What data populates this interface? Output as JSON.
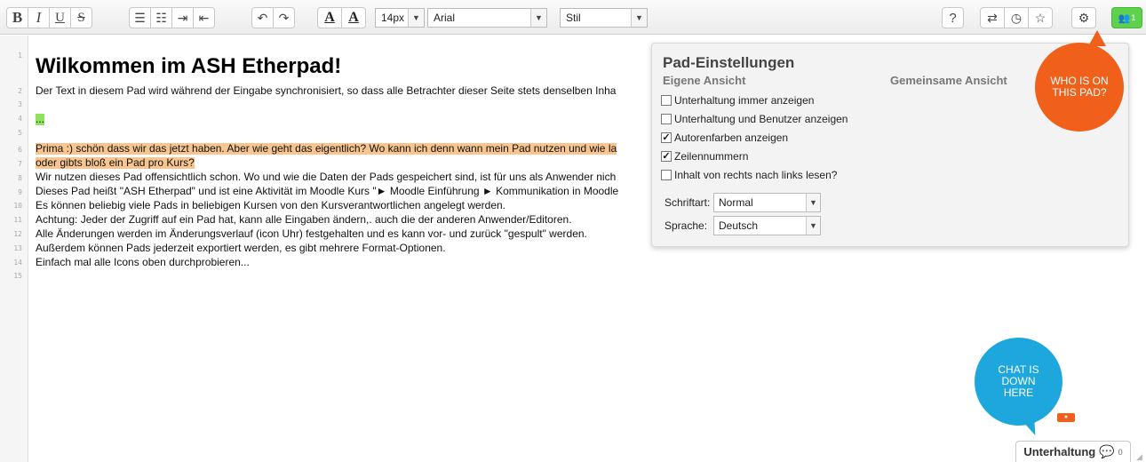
{
  "toolbar": {
    "bold_label": "B",
    "italic_label": "I",
    "underline_label": "U",
    "strike_label": "S",
    "font_color_label": "A",
    "bg_color_label": "A",
    "font_size": "14px",
    "font_family": "Arial",
    "style_select": "Stil",
    "help_label": "?",
    "user_count": "1"
  },
  "editor": {
    "line_numbers": [
      "1",
      "2",
      "3",
      "4",
      "5",
      "6",
      "7",
      "8",
      "9",
      "10",
      "11",
      "12",
      "13",
      "14",
      "15"
    ],
    "title": "Wilkommen im ASH Etherpad!",
    "line2": "Der Text in diesem Pad wird während der Eingabe synchronisiert, so dass alle Betrachter dieser Seite stets denselben Inha",
    "line4": "...",
    "line6": "Prima :) schön dass wir das jetzt haben. Aber wie geht das eigentlich? Wo kann ich denn wann mein Pad nutzen und wie la",
    "line7": "oder gibts bloß ein Pad pro Kurs?",
    "line8": "Wir nutzen dieses Pad offensichtlich schon.  Wo und wie die Daten der Pads gespeichert sind, ist für uns als Anwender nich",
    "line9": "Dieses Pad heißt \"ASH Etherpad\" und ist eine Aktivität im Moodle Kurs \"► Moodle Einführung  ► Kommunikation in Moodle",
    "line10": "Es können beliebig viele Pads in beliebigen Kursen von den Kursverantwortlichen angelegt werden.",
    "line11": "Achtung: Jeder der Zugriff auf ein Pad hat, kann alle Eingaben ändern,. auch die der anderen Anwender/Editoren.",
    "line12": "Alle Änderungen werden im Änderungsverlauf (icon Uhr)  festgehalten und es kann vor- und zurück \"gespult\" werden.",
    "line13": "Außerdem können Pads jederzeit  exportiert werden, es gibt mehrere Format-Optionen.",
    "line14": "Einfach mal alle Icons oben durchprobieren..."
  },
  "settings": {
    "title": "Pad-Einstellungen",
    "own_view": "Eigene Ansicht",
    "shared_view": "Gemeinsame Ansicht",
    "options": [
      {
        "label": "Unterhaltung immer anzeigen",
        "checked": "false"
      },
      {
        "label": "Unterhaltung und Benutzer anzeigen",
        "checked": "false"
      },
      {
        "label": "Autorenfarben anzeigen",
        "checked": "true"
      },
      {
        "label": "Zeilennummern",
        "checked": "true"
      },
      {
        "label": "Inhalt von rechts nach links lesen?",
        "checked": "false"
      }
    ],
    "font_label": "Schriftart:",
    "font_value": "Normal",
    "lang_label": "Sprache:",
    "lang_value": "Deutsch"
  },
  "bubbles": {
    "who": "WHO IS ON THIS PAD?",
    "chat": "CHAT IS DOWN HERE"
  },
  "chat": {
    "label": "Unterhaltung",
    "count": "0"
  },
  "colors": {
    "orange_highlight": "#f7c690",
    "green_highlight": "#8fe25c",
    "users_button": "#5ed24c",
    "orange_bubble": "#f0601a",
    "blue_bubble": "#1ea7dd"
  }
}
